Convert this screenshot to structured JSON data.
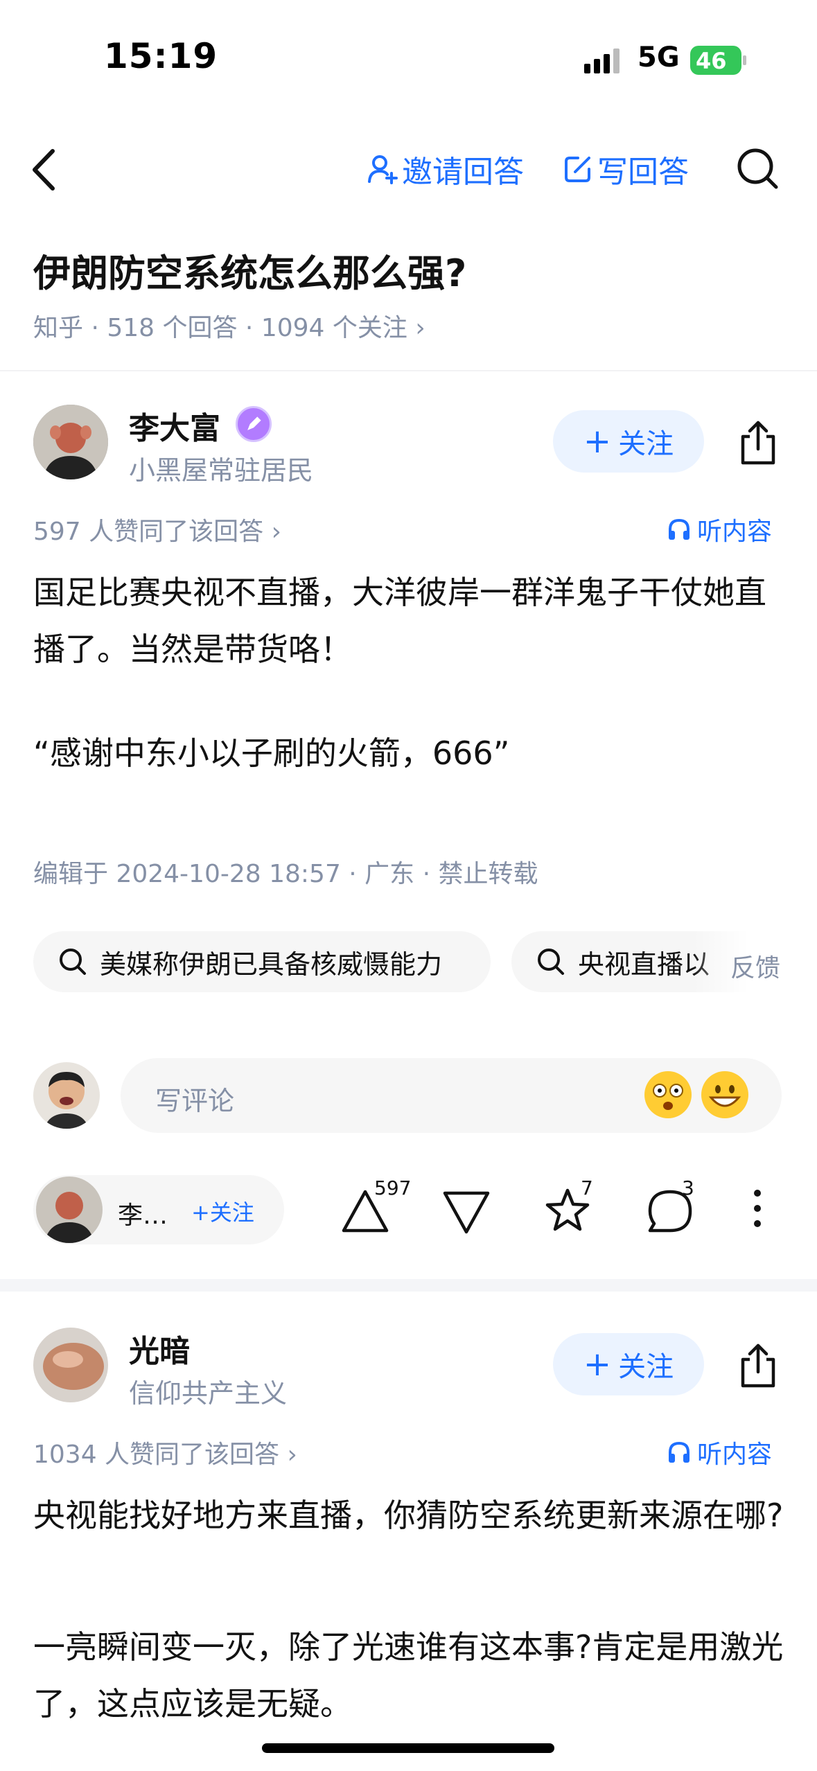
{
  "status_bar": {
    "time": "15:19",
    "network": "5G",
    "battery": "46"
  },
  "nav": {
    "invite_label": "邀请回答",
    "write_label": "写回答"
  },
  "question": {
    "title": "伊朗防空系统怎么那么强?",
    "meta": "知乎 · 518 个回答 · 1094 个关注 ›"
  },
  "answers": [
    {
      "author_name": "李大富",
      "author_bio": "小黑屋常驻居民",
      "follow_label": "关注",
      "votes_line": "597 人赞同了该回答 ›",
      "listen_label": "听内容",
      "paragraphs": [
        "国足比赛央视不直播，大洋彼岸一群洋鬼子干仗她直播了。当然是带货咯！",
        "“感谢中东小以子刷的火箭，666”"
      ],
      "edit_info": "编辑于 2024-10-28 18:57 · 广东 · 禁止转载",
      "related_searches": [
        "美媒称伊朗已具备核威慑能力",
        "央视直播以"
      ],
      "feedback_label": "反馈",
      "comment_placeholder": "写评论",
      "mini_author_name": "李…",
      "mini_follow_label": "+关注",
      "upvotes": "597",
      "favorites": "7",
      "comments": "3"
    },
    {
      "author_name": "光暗",
      "author_bio": "信仰共产主义",
      "follow_label": "关注",
      "votes_line": "1034 人赞同了该回答 ›",
      "listen_label": "听内容",
      "paragraphs": [
        "央视能找好地方来直播，你猜防空系统更新来源在哪?",
        "一亮瞬间变一灭，除了光速谁有这本事?肯定是用激光了，这点应该是无疑。"
      ]
    }
  ],
  "colors": {
    "accent": "#1e6fff",
    "muted": "#8590a6",
    "chip_bg": "#f6f6f6",
    "follow_bg": "#ebf3ff",
    "battery": "#34c759"
  }
}
